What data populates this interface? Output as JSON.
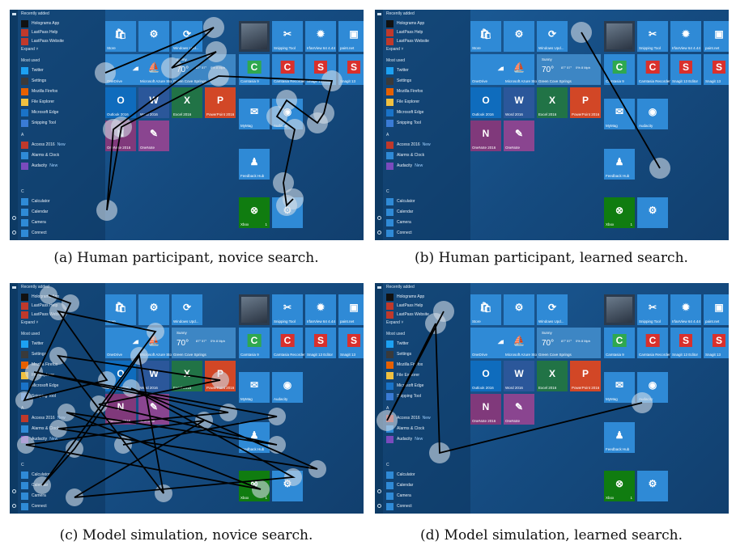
{
  "figure": {
    "panels": [
      {
        "id": "a",
        "caption": "(a) Human participant, novice search.",
        "type": "human-novice"
      },
      {
        "id": "b",
        "caption": "(b) Human participant, learned search.",
        "type": "human-learned"
      },
      {
        "id": "c",
        "caption": "(c) Model simulation, novice search.",
        "type": "model-novice"
      },
      {
        "id": "d",
        "caption": "(d) Model simulation, learned search.",
        "type": "model-learned"
      }
    ]
  },
  "start_menu": {
    "recently_added_label": "Recently added",
    "recent": [
      "Holograms App",
      "LastPass Help",
      "LastPass Website"
    ],
    "expand_label": "Expand",
    "most_used_label": "Most used",
    "most_used": [
      "Twitter",
      "Settings",
      "Mozilla Firefox",
      "File Explorer",
      "Microsoft Edge",
      "Snipping Tool"
    ],
    "section_a": [
      "Access 2016",
      "Alarms & Clock",
      "Audacity"
    ],
    "new_badge": "New",
    "section_c": [
      "Calculator",
      "Calendar",
      "Camera",
      "Connect"
    ],
    "tiles": {
      "store": "Store",
      "windows_update": "Windows Upd...",
      "onedrive": "OneDrive",
      "azure": "Microsoft Azure Storage...",
      "weather_cond": "Sunny",
      "weather_temp": "70°",
      "weather_detail": "87°\n57°",
      "weather_wind": "0%\n8 Mph",
      "weather_loc": "Green Cove Springs",
      "outlook": "Outlook 2016",
      "word": "Word 2016",
      "excel": "Excel 2016",
      "powerpoint": "PowerPoint 2016",
      "onenote": "OneNote 2016",
      "onenote2": "OneNote",
      "snipping": "Snipping Tool",
      "irfanview": "IrfanView 64 4.44",
      "paint": "paint.net",
      "camtasia": "Camtasia 9",
      "camrec": "Camtasia Recorder 9",
      "snagit": "Snagit 13 Editor",
      "snagit2": "Snagit 13",
      "mymag": "MyMag",
      "audacity": "Audacity",
      "feedback": "Feedback Hub",
      "xbox": "Xbox",
      "xbox_badge": "1"
    }
  },
  "colors": {
    "tile_blue": "#2f8ad6",
    "word": "#2b579a",
    "excel": "#217346",
    "ppt": "#d24726",
    "onenote": "#80397b",
    "xbox": "#107c10",
    "camtasia": "#2fa84f",
    "camrec": "#d9302c",
    "snagit": "#d9302c"
  }
}
